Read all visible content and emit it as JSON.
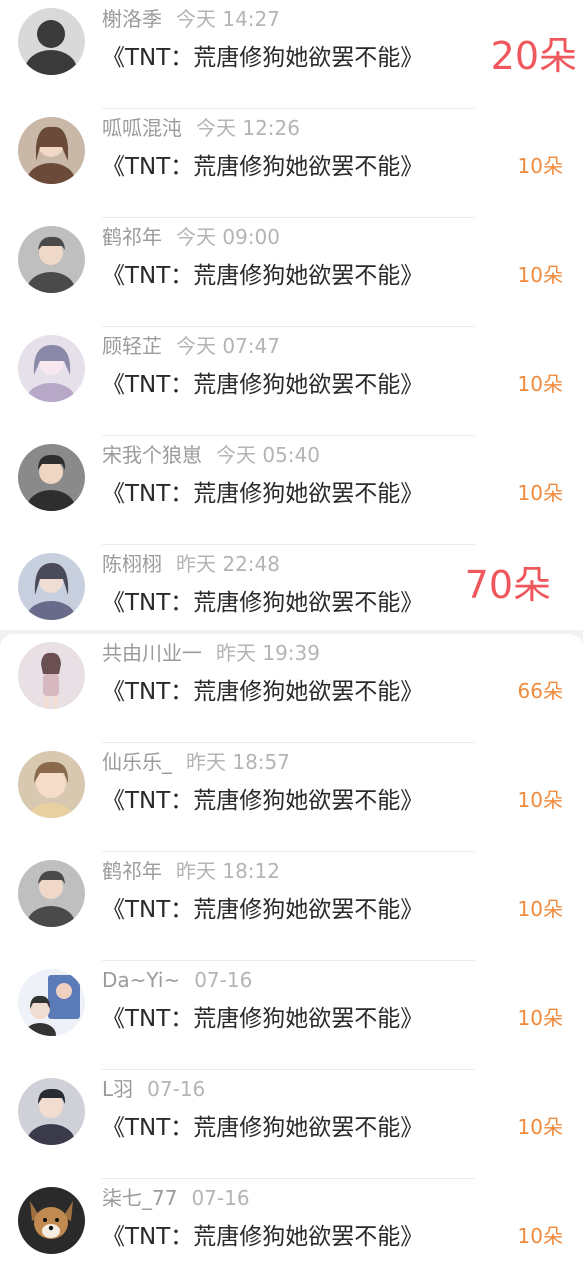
{
  "rows": [
    {
      "name": "榭洛季",
      "time": "今天 14:27",
      "title": "《TNT：荒唐修狗她欲罢不能》",
      "gift": "20朵",
      "avatar_icon": "avatar-dark-hair-icon",
      "avatar_color": "#3a3a3a"
    },
    {
      "name": "呱呱混沌",
      "time": "今天 12:26",
      "title": "《TNT：荒唐修狗她欲罢不能》",
      "gift": "10朵",
      "avatar_icon": "avatar-girl-icon",
      "avatar_color": "#6b4a3a"
    },
    {
      "name": "鹤祁年",
      "time": "今天 09:00",
      "title": "《TNT：荒唐修狗她欲罢不能》",
      "gift": "10朵",
      "avatar_icon": "avatar-boy-icon",
      "avatar_color": "#4a4a4a"
    },
    {
      "name": "顾轻芷",
      "time": "今天 07:47",
      "title": "《TNT：荒唐修狗她欲罢不能》",
      "gift": "10朵",
      "avatar_icon": "avatar-anime-icon",
      "avatar_color": "#8a8aa8"
    },
    {
      "name": "宋我个狼崽",
      "time": "今天 05:40",
      "title": "《TNT：荒唐修狗她欲罢不能》",
      "gift": "10朵",
      "avatar_icon": "avatar-boy-icon",
      "avatar_color": "#2e2e2e"
    },
    {
      "name": "陈栩栩",
      "time": "昨天 22:48",
      "title": "《TNT：荒唐修狗她欲罢不能》",
      "gift": "70朵",
      "avatar_icon": "avatar-girl-icon",
      "avatar_color": "#6a6a8a"
    },
    {
      "name": "共由川业一",
      "time": "昨天 19:39",
      "title": "《TNT：荒唐修狗她欲罢不能》",
      "gift": "66朵",
      "avatar_icon": "avatar-girl-icon",
      "avatar_color": "#d8b8c0"
    },
    {
      "name": "仙乐乐_",
      "time": "昨天 18:57",
      "title": "《TNT：荒唐修狗她欲罢不能》",
      "gift": "10朵",
      "avatar_icon": "avatar-child-icon",
      "avatar_color": "#8a6a4a"
    },
    {
      "name": "鹤祁年",
      "time": "昨天 18:12",
      "title": "《TNT：荒唐修狗她欲罢不能》",
      "gift": "10朵",
      "avatar_icon": "avatar-boy-icon",
      "avatar_color": "#4a4a4a"
    },
    {
      "name": "Da~Yi~",
      "time": "07-16",
      "title": "《TNT：荒唐修狗她欲罢不能》",
      "gift": "10朵",
      "avatar_icon": "avatar-cartoon-icon",
      "avatar_color": "#5a7ab8"
    },
    {
      "name": "L羽",
      "time": "07-16",
      "title": "《TNT：荒唐修狗她欲罢不能》",
      "gift": "10朵",
      "avatar_icon": "avatar-boy-icon",
      "avatar_color": "#3a3a4a"
    },
    {
      "name": "柒七_77",
      "time": "07-16",
      "title": "《TNT：荒唐修狗她欲罢不能》",
      "gift": "10朵",
      "avatar_icon": "avatar-dog-icon",
      "avatar_color": "#a07040"
    }
  ]
}
